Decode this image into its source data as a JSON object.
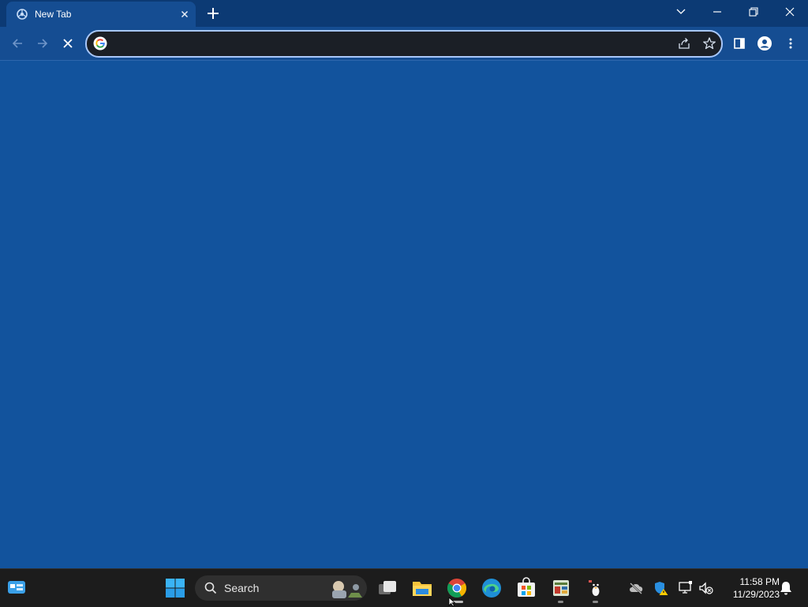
{
  "browser": {
    "tab": {
      "title": "New Tab"
    },
    "omnibox": {
      "value": "",
      "placeholder": ""
    }
  },
  "taskbar": {
    "search_label": "Search",
    "clock": {
      "time": "11:58 PM",
      "date": "11/29/2023"
    }
  },
  "colors": {
    "content_background": "#12539d",
    "tabstrip": "#0c3a74",
    "toolbar": "#154d92",
    "omnibox_border": "#a8c7fa",
    "taskbar": "#1c1c1c"
  },
  "icons": [
    "tab-favicon-icon",
    "close-icon",
    "plus-icon",
    "chevron-down-icon",
    "minimize-icon",
    "restore-icon",
    "back-arrow-icon",
    "forward-arrow-icon",
    "stop-loading-icon",
    "google-g-icon",
    "share-icon",
    "star-icon",
    "side-panel-icon",
    "profile-icon",
    "more-vert-icon",
    "widgets-icon",
    "windows-start-icon",
    "search-icon",
    "task-view-icon",
    "file-explorer-icon",
    "chrome-icon",
    "edge-icon",
    "store-icon",
    "app-icon",
    "penguin-app-icon",
    "cloud-off-icon",
    "defender-warning-icon",
    "network-icon",
    "volume-muted-icon",
    "bell-icon"
  ]
}
